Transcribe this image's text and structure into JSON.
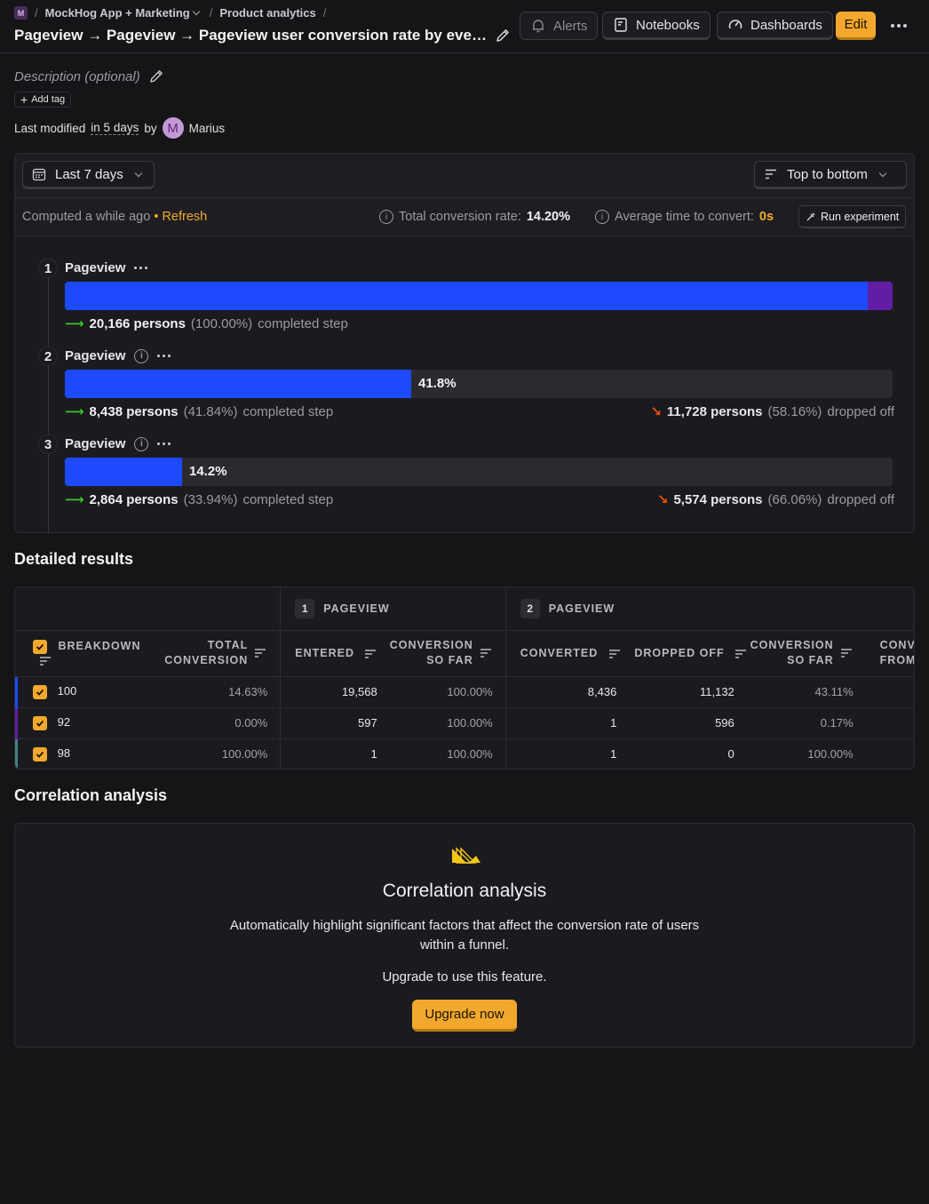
{
  "breadcrumbs": {
    "project_badge": "M",
    "project": "MockHog App + Marketing",
    "section": "Product analytics"
  },
  "title": "Pageview → Pageview → Pageview user conversion rate by even…",
  "header_buttons": {
    "alerts": "Alerts",
    "notebooks": "Notebooks",
    "dashboards": "Dashboards",
    "edit": "Edit"
  },
  "description_placeholder": "Description (optional)",
  "add_tag": "Add tag",
  "last_modified": {
    "prefix": "Last modified",
    "when": "in 5 days",
    "by": "by",
    "avatar_letter": "M",
    "user": "Marius"
  },
  "controls": {
    "date_range": "Last 7 days",
    "layout": "Top to bottom"
  },
  "summary": {
    "computed": "Computed a while ago",
    "bullet": "•",
    "refresh": "Refresh",
    "total_label": "Total conversion rate:",
    "total_value": "14.20%",
    "avg_label": "Average time to convert:",
    "avg_value": "0s",
    "run_experiment": "Run experiment"
  },
  "steps": [
    {
      "num": "1",
      "name": "Pageview",
      "fill": 1.0,
      "bar_label": "",
      "persons": "20,166 persons",
      "pct": "(100.00%)",
      "completed": "completed step",
      "dropped": "",
      "dropped_pct": "",
      "dropped_text": ""
    },
    {
      "num": "2",
      "name": "Pageview",
      "fill": 0.418,
      "bar_label": "41.8%",
      "persons": "8,438 persons",
      "pct": "(41.84%)",
      "completed": "completed step",
      "dropped": "11,728 persons",
      "dropped_pct": "(58.16%)",
      "dropped_text": "dropped off"
    },
    {
      "num": "3",
      "name": "Pageview",
      "fill": 0.142,
      "bar_label": "14.2%",
      "persons": "2,864 persons",
      "pct": "(33.94%)",
      "completed": "completed step",
      "dropped": "5,574 persons",
      "dropped_pct": "(66.06%)",
      "dropped_text": "dropped off"
    }
  ],
  "detailed_results": {
    "heading": "Detailed results",
    "group1": {
      "num": "1",
      "label": "PAGEVIEW"
    },
    "group2": {
      "num": "2",
      "label": "PAGEVIEW"
    },
    "columns": {
      "breakdown": "BREAKDOWN",
      "total_conversion_1": "TOTAL",
      "total_conversion_2": "CONVERSION",
      "entered": "ENTERED",
      "conv_so_far_1": "CONVERSION",
      "conv_so_far_2": "SO FAR",
      "converted": "CONVERTED",
      "dropped_off": "DROPPED OFF",
      "conv_so_far2_1": "CONVERSION",
      "conv_so_far2_2": "SO FAR",
      "conv_prev_1": "CONV",
      "conv_prev_2": "FROM PR"
    },
    "rows": [
      {
        "breakdown": "100",
        "color": "#1d4aff",
        "total": "14.63%",
        "entered": "19,568",
        "so_far": "100.00%",
        "converted": "8,436",
        "dropped": "11,132",
        "so_far2": "43.11%"
      },
      {
        "breakdown": "92",
        "color": "#621da6",
        "total": "0.00%",
        "entered": "597",
        "so_far": "100.00%",
        "converted": "1",
        "dropped": "596",
        "so_far2": "0.17%"
      },
      {
        "breakdown": "98",
        "color": "#42827e",
        "total": "100.00%",
        "entered": "1",
        "so_far": "100.00%",
        "converted": "1",
        "dropped": "0",
        "so_far2": "100.00%"
      }
    ]
  },
  "correlation": {
    "heading": "Correlation analysis",
    "title": "Correlation analysis",
    "description": "Automatically highlight significant factors that affect the conversion rate of users within a funnel.",
    "upgrade_text": "Upgrade to use this feature.",
    "upgrade_button": "Upgrade now"
  },
  "colors": {
    "accent": "#f1a82c",
    "bar_blue": "#1d4aff",
    "bar_purple": "#621da6",
    "success": "#34c924",
    "danger": "#f54e00"
  }
}
